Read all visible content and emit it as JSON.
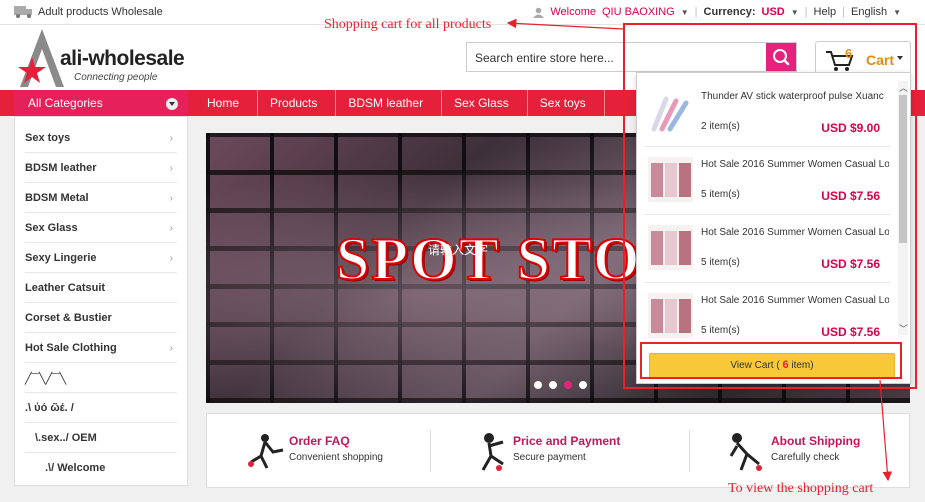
{
  "topbar": {
    "wholesale": "Adult products Wholesale",
    "welcome": "Welcome",
    "user": "QIU BAOXING",
    "currency_label": "Currency:",
    "currency": "USD",
    "help": "Help",
    "language": "English"
  },
  "header": {
    "brand": "ali-wholesale",
    "tagline": "Connecting people",
    "search_placeholder": "Search entire store here...",
    "cart_count": "6",
    "cart_label": "Cart"
  },
  "annotations": {
    "cart_note": "Shopping cart for all products",
    "view_note": "To view the shopping cart"
  },
  "nav": {
    "all_categories": "All Categories",
    "links": [
      "Home",
      "Products",
      "BDSM leather",
      "Sex Glass",
      "Sex toys"
    ]
  },
  "sidebar": {
    "items": [
      {
        "label": "Sex toys",
        "arrow": true
      },
      {
        "label": "BDSM leather",
        "arrow": true
      },
      {
        "label": "BDSM Metal",
        "arrow": true
      },
      {
        "label": "Sex Glass",
        "arrow": true
      },
      {
        "label": "Sexy Lingerie",
        "arrow": true
      },
      {
        "label": "Leather Catsuit",
        "arrow": false
      },
      {
        "label": "Corset & Bustier",
        "arrow": false
      },
      {
        "label": "Hot Sale Clothing",
        "arrow": true
      },
      {
        "label": "╱‾‾╲╱‾‾╲",
        "arrow": false
      },
      {
        "label": ".\\   ὐό ῶέ.   /",
        "arrow": false
      },
      {
        "label": "\\.sex../  OEM",
        "arrow": false
      },
      {
        "label": ".\\/  Welcome",
        "arrow": false
      }
    ]
  },
  "banner": {
    "headline": "SPOT STO",
    "overlay_cn": "请输入文字"
  },
  "info": [
    {
      "title": "Order FAQ",
      "sub": "Convenient shopping"
    },
    {
      "title": "Price and Payment",
      "sub": "Secure payment"
    },
    {
      "title": "About Shipping",
      "sub": "Carefully check"
    }
  ],
  "cart": {
    "items": [
      {
        "name": "Thunder AV stick waterproof pulse Xuanc",
        "qty": "2 item(s)",
        "price": "USD $9.00"
      },
      {
        "name": "Hot Sale 2016 Summer Women Casual Lo",
        "qty": "5 item(s)",
        "price": "USD $7.56"
      },
      {
        "name": "Hot Sale 2016 Summer Women Casual Lo",
        "qty": "5 item(s)",
        "price": "USD $7.56"
      },
      {
        "name": "Hot Sale 2016 Summer Women Casual Lo",
        "qty": "5 item(s)",
        "price": "USD $7.56"
      }
    ],
    "view_prefix": "View Cart ( ",
    "view_count": "6",
    "view_suffix": " item)"
  },
  "colors": {
    "accent": "#e5203a",
    "pink": "#e5237f",
    "price": "#d9004a",
    "annotation": "#e8212d"
  }
}
